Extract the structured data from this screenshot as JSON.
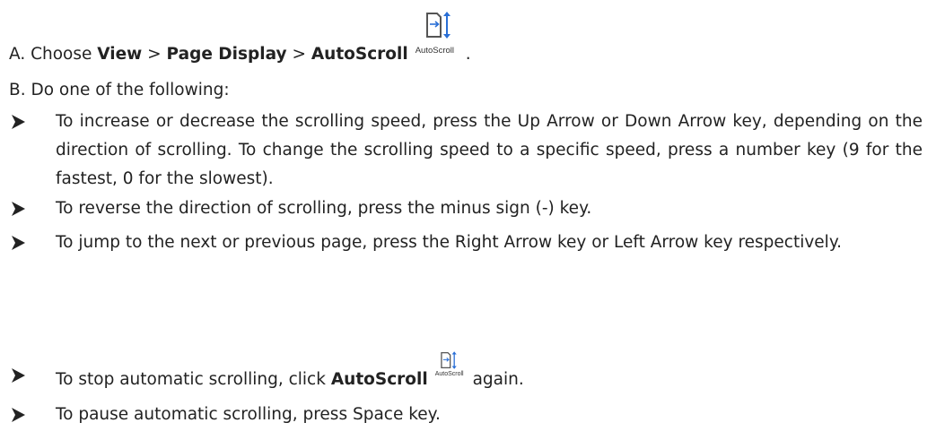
{
  "step_a": {
    "prefix": "A. Choose ",
    "view": "View",
    "sep1": " > ",
    "page_display": "Page Display",
    "sep2": " > ",
    "autoscroll": "AutoScroll",
    "icon_caption": "AutoScroll",
    "end": "."
  },
  "step_b": "B. Do one of the following:",
  "bullets": [
    "To increase or decrease the scrolling speed, press the Up Arrow or Down Arrow key, depending on the direction of scrolling. To change the scrolling speed to a specific speed, press a number key (9 for the fastest, 0 for the slowest).",
    "To reverse the direction of scrolling, press the minus sign (-) key.",
    "To jump to the next or previous page, press the Right Arrow key or Left Arrow key respectively."
  ],
  "stop": {
    "prefix": "To stop automatic scrolling, click ",
    "autoscroll": "AutoScroll",
    "icon_caption": "AutoScroll",
    "suffix": " again."
  },
  "pause": "To pause automatic scrolling, press Space key.",
  "icons": {
    "bullet": "arrowhead-bullet-icon",
    "autoscroll": "autoscroll-icon"
  },
  "colors": {
    "text": "#222222",
    "icon_blue": "#2a6fd6",
    "icon_gray": "#555555"
  }
}
